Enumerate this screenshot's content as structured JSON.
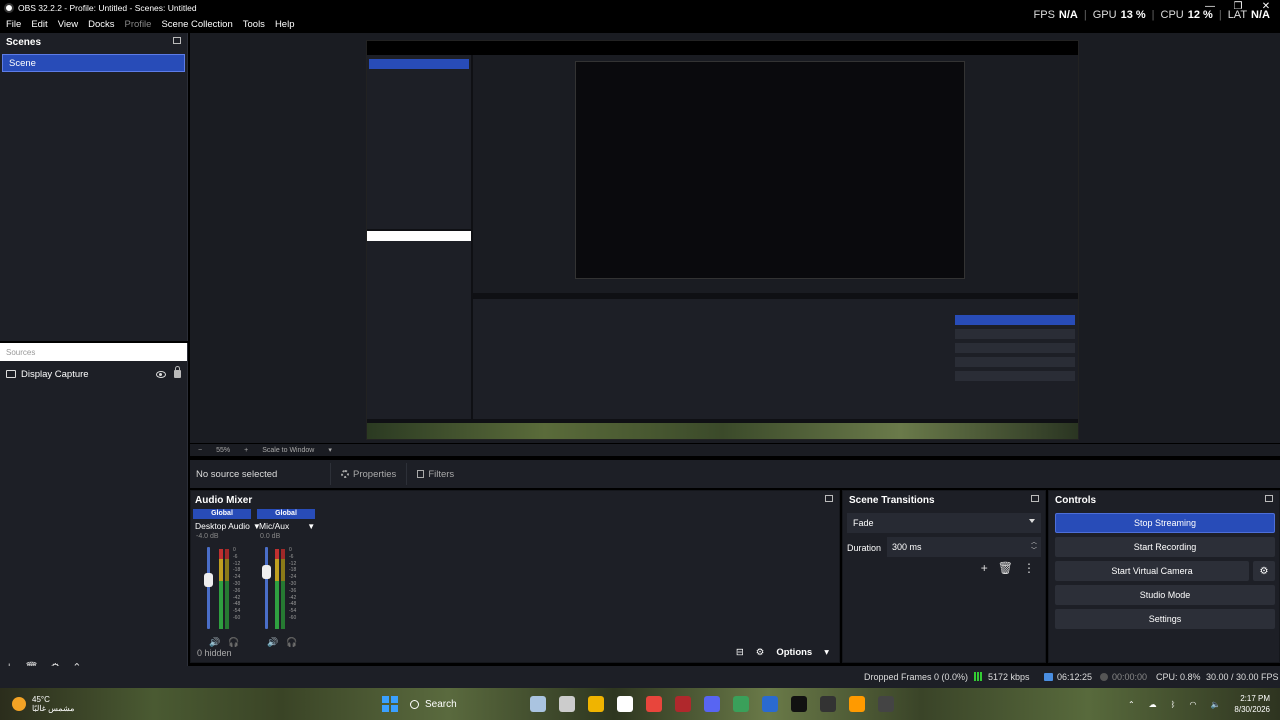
{
  "window": {
    "title": "OBS 32.2.2 - Profile: Untitled - Scenes: Untitled",
    "controls": [
      "—",
      "❐",
      "✕"
    ]
  },
  "menu": {
    "file": "File",
    "edit": "Edit",
    "view": "View",
    "docks": "Docks",
    "profile": "Profile",
    "scene_collection": "Scene Collection",
    "tools": "Tools",
    "help": "Help"
  },
  "stats": {
    "fps_label": "FPS",
    "fps_value": "N/A",
    "gpu_label": "GPU",
    "gpu_value": "13 %",
    "cpu_label": "CPU",
    "cpu_value": "12 %",
    "lat_label": "LAT",
    "lat_value": "N/A"
  },
  "scenes": {
    "header": "Scenes",
    "items": [
      "Scene"
    ]
  },
  "sources": {
    "header": "Sources",
    "items": [
      "Display Capture"
    ]
  },
  "preview_toolbar": {
    "zoom": "55%",
    "mode": "Scale to Window"
  },
  "properties_bar": {
    "no_source": "No source selected",
    "properties": "Properties",
    "filters": "Filters"
  },
  "audio_mixer": {
    "header": "Audio Mixer",
    "channels": [
      {
        "tag": "Global",
        "name": "Desktop Audio",
        "db": "-4.0 dB"
      },
      {
        "tag": "Global",
        "name": "Mic/Aux",
        "db": "0.0 dB"
      }
    ],
    "ticks": [
      "0",
      "-6",
      "-12",
      "-18",
      "-24",
      "-30",
      "-36",
      "-42",
      "-48",
      "-54",
      "-60"
    ],
    "hidden": "0 hidden",
    "options": "Options"
  },
  "scene_transitions": {
    "header": "Scene Transitions",
    "transition": "Fade",
    "duration_label": "Duration",
    "duration_value": "300 ms"
  },
  "controls": {
    "header": "Controls",
    "stop_streaming": "Stop Streaming",
    "start_recording": "Start Recording",
    "start_virtual_camera": "Start Virtual Camera",
    "studio_mode": "Studio Mode",
    "settings": "Settings"
  },
  "status_bar": {
    "dropped_frames": "Dropped Frames 0 (0.0%)",
    "bitrate": "5172 kbps",
    "stream_time": "06:12:25",
    "record_time": "00:00:00",
    "cpu": "CPU: 0.8%",
    "fps": "30.00 / 30.00 FPS"
  },
  "taskbar": {
    "temperature": "45°C",
    "weather": "مشمس غالبًا",
    "search": "Search",
    "time": "2:17 PM",
    "date": "8/30/2026",
    "app_colors": [
      "#aac4e0",
      "#cccccc",
      "#f0b400",
      "#ffffff",
      "#e8453c",
      "#b0282c",
      "#5865f2",
      "#3aa05a",
      "#2a6ad0",
      "#111111",
      "#333333",
      "#ff9a00",
      "#444444"
    ]
  }
}
